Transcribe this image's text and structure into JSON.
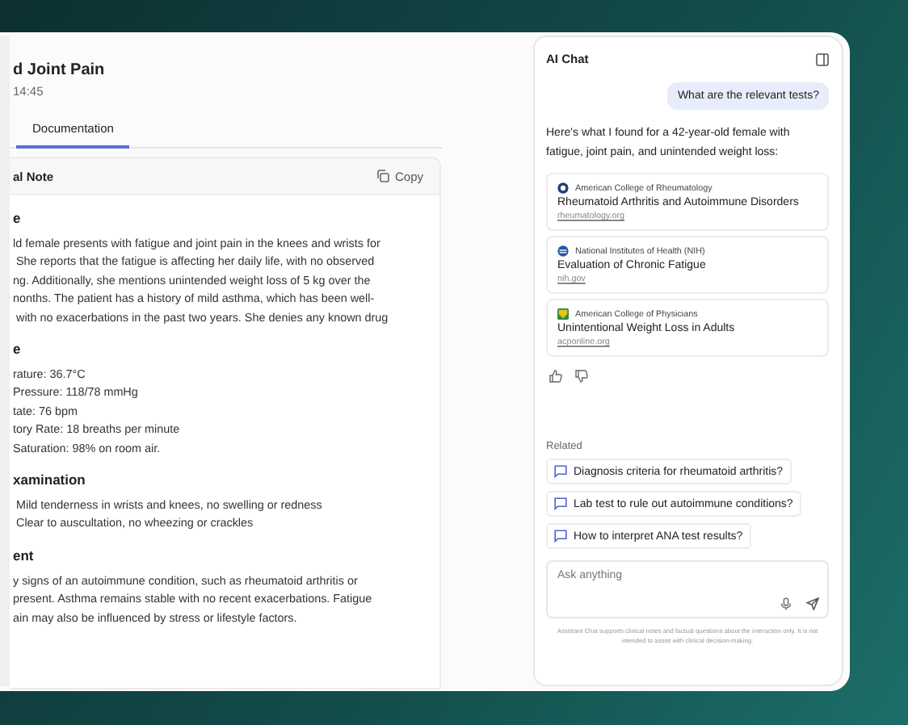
{
  "note": {
    "title": "d Joint Pain",
    "time": "14:45",
    "tabs": [
      {
        "label": "Documentation",
        "selected": true
      }
    ],
    "card_title": "al Note",
    "copy_button": "Copy",
    "sections": [
      {
        "heading": "e",
        "lines": [
          "ld female presents with fatigue and joint pain in the knees and wrists for",
          " She reports that the fatigue is affecting her daily life, with no observed",
          "ng. Additionally, she mentions unintended weight loss of 5 kg over the",
          "nonths. The patient has a history of mild asthma, which has been well-",
          " with no exacerbations in the past two years. She denies any known drug"
        ]
      },
      {
        "heading": "e",
        "lines": [
          "rature: 36.7°C",
          "Pressure: 118/78 mmHg",
          "tate: 76 bpm",
          "tory Rate: 18 breaths per minute",
          "Saturation: 98% on room air."
        ]
      },
      {
        "heading": "xamination",
        "lines": [
          " Mild tenderness in wrists and knees, no swelling or redness",
          " Clear to auscultation, no wheezing or crackles"
        ]
      },
      {
        "heading": "ent",
        "lines": [
          "y signs of an autoimmune condition, such as rheumatoid arthritis or",
          "present. Asthma remains stable with no recent exacerbations. Fatigue",
          "ain may also be influenced by stress or lifestyle factors."
        ]
      }
    ]
  },
  "chat": {
    "title": "AI Chat",
    "user_message": "What are the relevant tests?",
    "answer": "Here's what I found for a 42-year-old female with fatigue, joint pain, and unintended weight loss:",
    "sources": [
      {
        "kind": "seal",
        "publisher": "American College of Rheumatology",
        "title": "Rheumatoid Arthritis and Autoimmune Disorders",
        "domain": "rheumatology.org"
      },
      {
        "kind": "stripes",
        "publisher": "National Institutes of Health (NIH)",
        "title": "Evaluation of Chronic Fatigue",
        "domain": "nih.gov"
      },
      {
        "kind": "shield",
        "publisher": "American College of Physicians",
        "title": "Unintentional Weight Loss in Adults",
        "domain": "acponline.org"
      }
    ],
    "related_label": "Related",
    "related": [
      "Diagnosis criteria for rheumatoid arthritis?",
      "Lab test to rule out autoimmune conditions?",
      "How to interpret ANA test results?"
    ],
    "input": {
      "placeholder": "Ask anything"
    },
    "disclaimer": "Assistant Chat supports clinical notes and factual questions about the interaction only. It is not intended to assist with clinical decision-making."
  }
}
